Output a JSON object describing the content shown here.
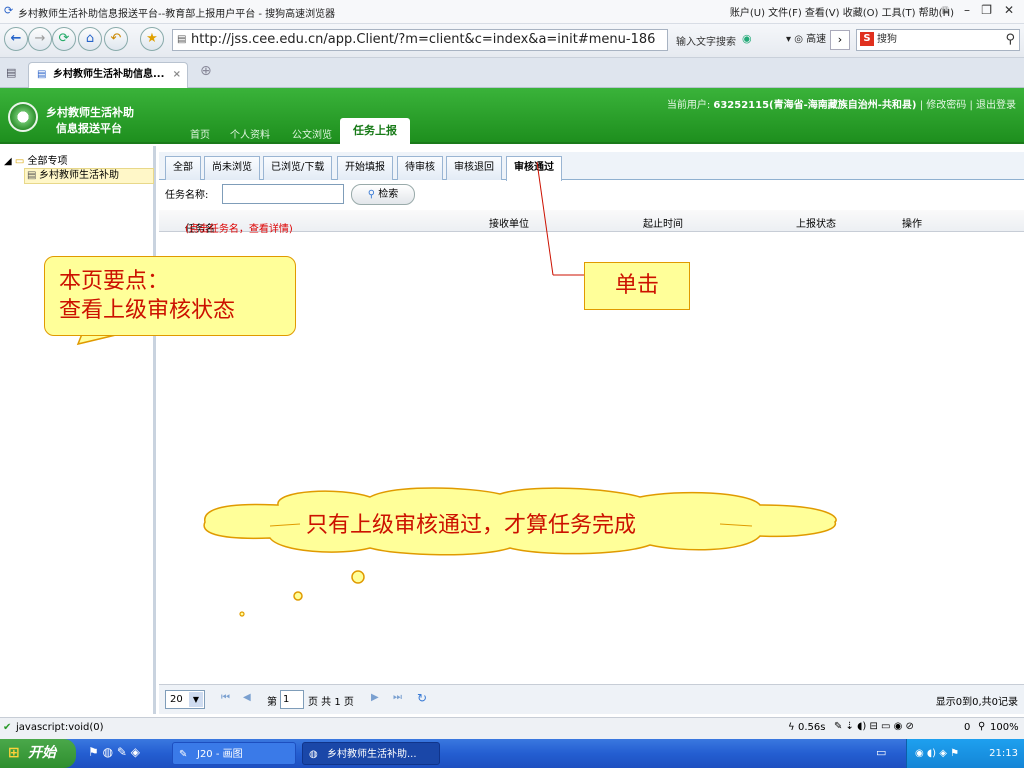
{
  "browser": {
    "title": "乡村教师生活补助信息报送平台--教育部上报用户平台 - 搜狗高速浏览器",
    "menu": "账户(U)  文件(F)  查看(V)  收藏(O)  工具(T)  帮助(H)",
    "url": "http://jss.cee.edu.cn/app.Client/?m=client&c=index&a=init#menu-186",
    "url_hint": "输入文字搜索",
    "speed_label": "高速",
    "search_placeholder": "搜狗",
    "tab_title": "乡村教师生活补助信息...",
    "tab_close": "×",
    "new_tab": "⊕"
  },
  "app": {
    "logo_line1": "乡村教师生活补助",
    "logo_line2": "信息报送平台",
    "nav": [
      "首页",
      "个人资料",
      "公文浏览",
      "任务上报"
    ],
    "user_prefix": "当前用户:",
    "user_name": "63252115(青海省-海南藏族自治州-共和县)",
    "change_pwd": "修改密码",
    "logout": "退出登录",
    "sep": "|"
  },
  "sidebar": {
    "root": "全部专项",
    "item": "乡村教师生活补助"
  },
  "main": {
    "tabs": [
      "全部",
      "尚未浏览",
      "已浏览/下载",
      "开始填报",
      "待审核",
      "审核退回",
      "审核通过"
    ],
    "active_tab": "审核通过",
    "search_label": "任务名称:",
    "search_button": "检索",
    "columns": {
      "name": "任务名",
      "name_hint": "(点击任务名，查看详情)",
      "receiver": "接收单位",
      "period": "起止时间",
      "status": "上报状态",
      "action": "操作"
    }
  },
  "pager": {
    "page_size": "20",
    "page_prefix": "第",
    "page_value": "1",
    "page_suffix": "页 共 1 页",
    "summary": "显示0到0,共0记录"
  },
  "statusbar": {
    "left": "javascript:void(0)",
    "time": "0.56s",
    "zoom": "100%",
    "count": "0"
  },
  "taskbar": {
    "start": "开始",
    "task1": "J20 - 画图",
    "task2": "乡村教师生活补助...",
    "clock": "21:13"
  },
  "annotations": {
    "callout1_line1": "本页要点：",
    "callout1_line2": "查看上级审核状态",
    "callout2": "单击",
    "cloud": "只有上级审核通过，才算任务完成"
  },
  "colors": {
    "header_green": "#2ea52e",
    "callout_fill": "#ffff99",
    "callout_text": "#cc1100",
    "hint_red": "#dd0000"
  }
}
